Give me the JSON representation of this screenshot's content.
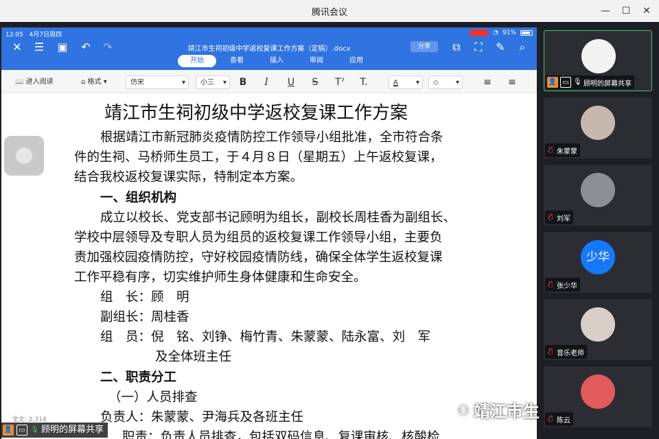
{
  "window": {
    "title": "腾讯会议"
  },
  "wps": {
    "status_time": "12:05",
    "status_date": "4月7日周四",
    "battery": "91%",
    "doc_name": "靖江市生祠初级中学返校复课工作方案（定稿）.docx",
    "share_label": "分享",
    "tabs": [
      "开始",
      "查看",
      "插入",
      "审阅",
      "应用"
    ],
    "active_tab": "开始",
    "format": {
      "read_mode": "进入阅读",
      "style": "格式",
      "font": "仿宋",
      "size": "小三"
    },
    "word_count": "全文: 2,314"
  },
  "document": {
    "title": "靖江市生祠初级中学返校复课工作方案",
    "lines": [
      "根据靖江市新冠肺炎疫情防控工作领导小组批准，全市符合条",
      "件的生祠、马桥师生员工，于４月８日（星期五）上午返校复课，",
      "结合我校返校复课实际，特制定本方案。",
      "一、组织机构",
      "成立以校长、党支部书记顾明为组长，副校长周桂香为副组长、",
      "学校中层领导及专职人员为组员的返校复课工作领导小组，主要负",
      "责加强校园疫情防控，守好校园疫情防线，确保全体学生返校复课",
      "工作平稳有序，切实维护师生身体健康和生命安全。",
      "组　长：顾　明",
      "副组长：周桂香",
      "组　员：倪　铭、刘铮、梅竹青、朱蒙蒙、陆永富、刘　军",
      "及全体班主任",
      "二、职责分工",
      "（一）人员排查",
      "负责人：朱蒙蒙、尹海兵及各班主任",
      "职责：负责人员排查，包括双码信息、复课审核、核酸检"
    ]
  },
  "sharer": {
    "label": "顾明的屏幕共享"
  },
  "watermark": {
    "text": "靖江市生祠初级中学"
  },
  "participants": [
    {
      "name": "顾明的屏幕共享",
      "mic": "on",
      "active": true,
      "avatar_color": "#f3f3f3"
    },
    {
      "name": "朱蒙蒙",
      "mic": "off",
      "active": false,
      "avatar_color": "#c7b8ad"
    },
    {
      "name": "刘军",
      "mic": "off",
      "active": false,
      "avatar_color": "#8d8f96"
    },
    {
      "name": "张少华",
      "mic": "off",
      "active": false,
      "avatar_color": "#1677ff",
      "initials": "少华"
    },
    {
      "name": "音乐老师",
      "mic": "off",
      "active": false,
      "avatar_color": "#d9cfc9"
    },
    {
      "name": "陈云",
      "mic": "off",
      "active": false,
      "avatar_color": "#e35a5a"
    }
  ]
}
